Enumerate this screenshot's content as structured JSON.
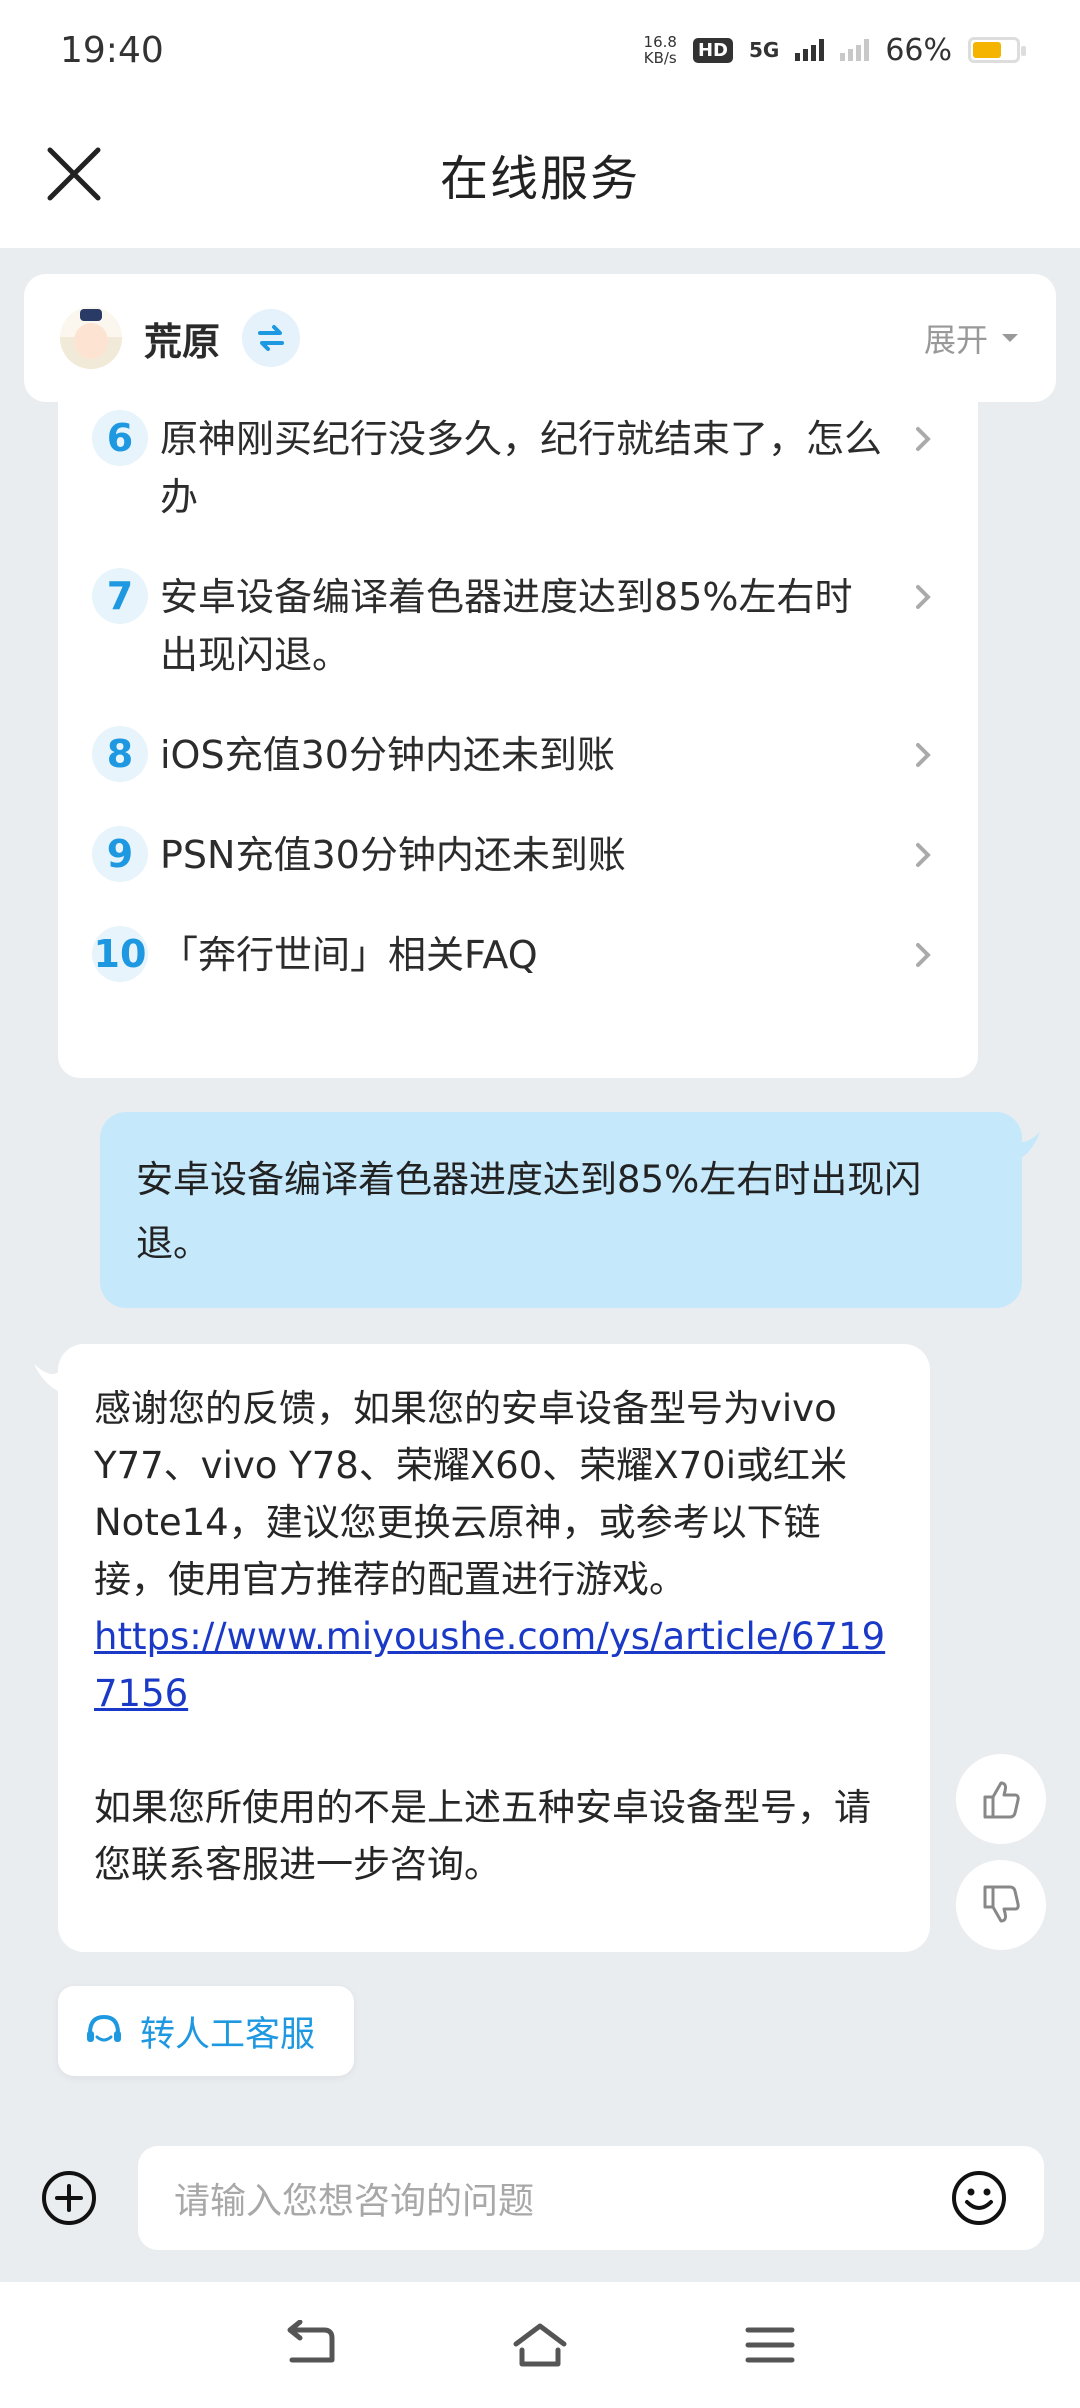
{
  "status_bar": {
    "time": "19:40",
    "net_speed_value": "16.8",
    "net_speed_unit": "KB/s",
    "hd_label": "HD",
    "network_label": "5G",
    "battery_percent": "66%",
    "battery_level": 0.66,
    "battery_color": "#f5b400"
  },
  "header": {
    "title": "在线服务",
    "close_icon": "close-icon"
  },
  "game_selector": {
    "name": "荒原",
    "expand_label": "展开",
    "switch_icon": "swap-arrows-icon"
  },
  "faq_list": [
    {
      "num": "6",
      "text": "原神刚买纪行没多久，纪行就结束了，怎么办"
    },
    {
      "num": "7",
      "text": "安卓设备编译着色器进度达到85%左右时出现闪退。"
    },
    {
      "num": "8",
      "text": "iOS充值30分钟内还未到账"
    },
    {
      "num": "9",
      "text": "PSN充值30分钟内还未到账"
    },
    {
      "num": "10",
      "text": "「奔行世间」相关FAQ"
    }
  ],
  "user_message": "安卓设备编译着色器进度达到85%左右时出现闪退。",
  "bot_message": {
    "text_1": "感谢您的反馈，如果您的安卓设备型号为vivo Y77、vivo Y78、荣耀X60、荣耀X70i或红米Note14，建议您更换云原神，或参考以下链接，使用官方推荐的配置进行游戏。",
    "link": "https://www.miyoushe.com/ys/article/67197156",
    "text_2": "如果您所使用的不是上述五种安卓设备型号，请您联系客服进一步咨询。"
  },
  "transfer_button": "转人工客服",
  "input": {
    "placeholder": "请输入您想咨询的问题"
  },
  "colors": {
    "accent": "#1e98e0",
    "user_bubble": "#c5e8fb",
    "link": "#1a39c7",
    "background": "#e9edf0"
  }
}
